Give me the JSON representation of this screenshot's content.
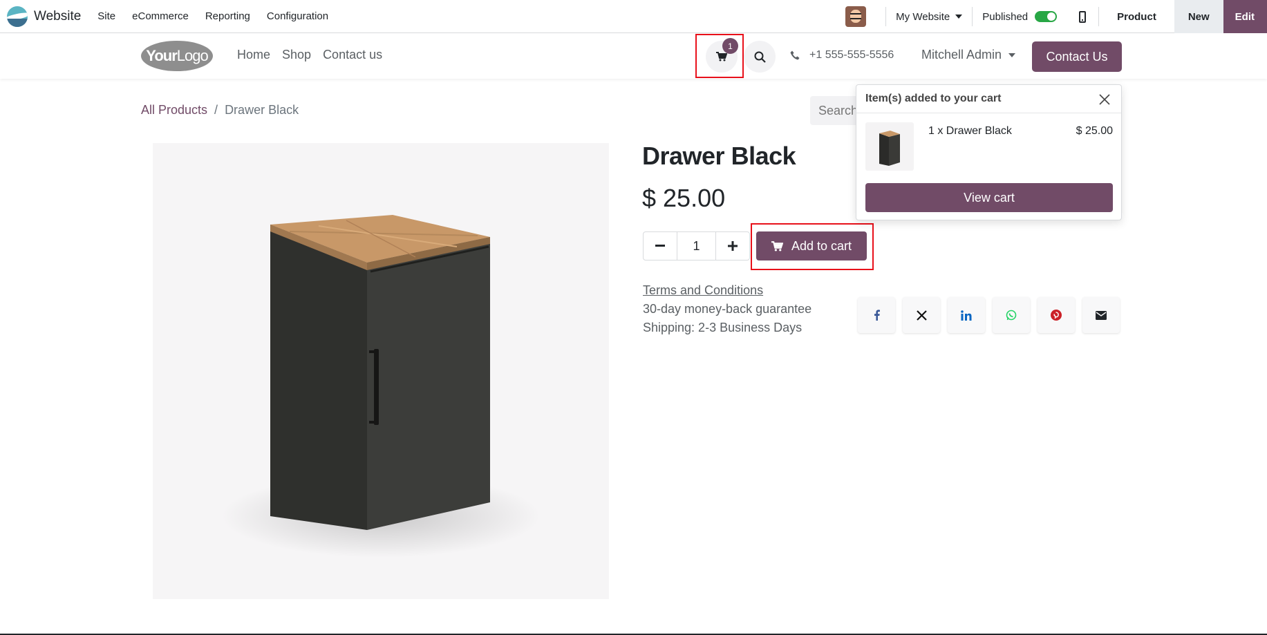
{
  "topbar": {
    "app_name": "Website",
    "menu": [
      "Site",
      "eCommerce",
      "Reporting",
      "Configuration"
    ],
    "website_select": "My Website",
    "published_label": "Published",
    "published": true,
    "product_label": "Product",
    "new_label": "New",
    "edit_label": "Edit"
  },
  "site": {
    "logo_bold": "Your",
    "logo_thin": "Logo",
    "nav": [
      "Home",
      "Shop",
      "Contact us"
    ],
    "cart_count": "1",
    "phone": "+1 555-555-5556",
    "user": "Mitchell Admin",
    "contact_button": "Contact Us"
  },
  "breadcrumb": {
    "parent": "All Products",
    "separator": "/",
    "current": "Drawer Black"
  },
  "search": {
    "placeholder": "Search..."
  },
  "product": {
    "name": "Drawer Black",
    "price": "$ 25.00",
    "quantity": "1",
    "add_to_cart": "Add to cart",
    "terms": "Terms and Conditions",
    "guarantee": "30-day money-back guarantee",
    "shipping": "Shipping: 2-3 Business Days",
    "share_icons": [
      "facebook-icon",
      "x-icon",
      "linkedin-icon",
      "whatsapp-icon",
      "pinterest-icon",
      "envelope-icon"
    ]
  },
  "cart_popup": {
    "title": "Item(s) added to your cart",
    "item": "1 x Drawer Black",
    "item_price": "$ 25.00",
    "view_cart": "View cart"
  },
  "colors": {
    "brand": "#714b67",
    "highlight": "#e8101a",
    "published_toggle": "#28a745"
  }
}
